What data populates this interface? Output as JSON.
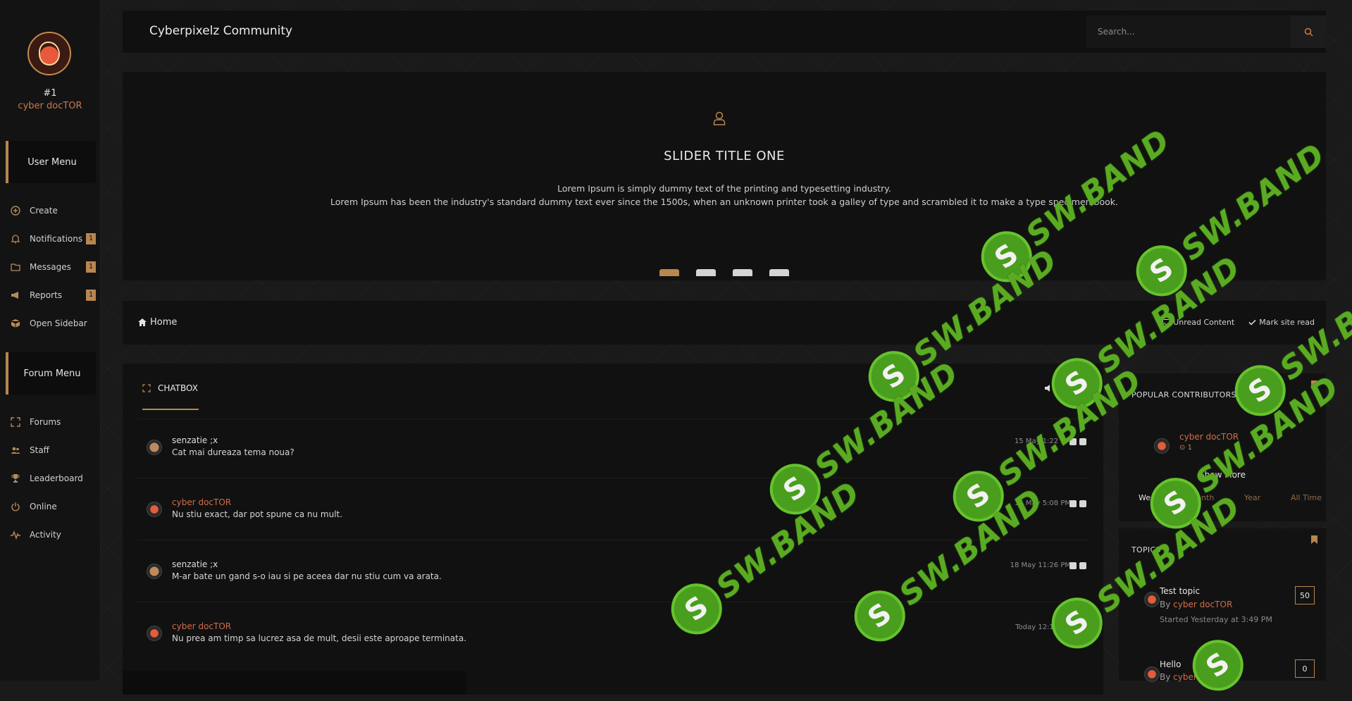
{
  "sidebar": {
    "rank": "#1",
    "username": "cyber docTOR",
    "user_menu_label": "User Menu",
    "user_items": [
      {
        "label": "Create",
        "icon": "plus-circle-icon",
        "badge": ""
      },
      {
        "label": "Notifications",
        "icon": "bell-icon",
        "badge": "1"
      },
      {
        "label": "Messages",
        "icon": "folder-icon",
        "badge": "1"
      },
      {
        "label": "Reports",
        "icon": "megaphone-icon",
        "badge": "1"
      },
      {
        "label": "Open Sidebar",
        "icon": "cube-icon",
        "badge": ""
      }
    ],
    "forum_menu_label": "Forum Menu",
    "forum_items": [
      {
        "label": "Forums",
        "icon": "expand-icon"
      },
      {
        "label": "Staff",
        "icon": "users-icon"
      },
      {
        "label": "Leaderboard",
        "icon": "trophy-icon"
      },
      {
        "label": "Online",
        "icon": "power-icon"
      },
      {
        "label": "Activity",
        "icon": "pulse-icon"
      }
    ]
  },
  "header": {
    "title": "Cyberpixelz Community",
    "search_placeholder": "Search..."
  },
  "slider": {
    "title": "SLIDER TITLE ONE",
    "line1": "Lorem Ipsum is simply dummy text of the printing and typesetting industry.",
    "line2": "Lorem Ipsum has been the industry's standard dummy text ever since the 1500s, when an unknown printer took a galley of type and scrambled it to make a type specimen book.",
    "slides": 4,
    "active_slide": 1
  },
  "breadcrumb": {
    "home": "Home",
    "unread": "Unread Content",
    "mark_read": "Mark site read"
  },
  "chatbox": {
    "tab_label": "CHATBOX",
    "messages": [
      {
        "author": "senzatie ;x",
        "text": "Cat mai dureaza tema noua?",
        "time": "15 May 1:22 PM",
        "avatar": "s"
      },
      {
        "author": "cyber docTOR",
        "text": "Nu stiu exact, dar pot spune ca nu mult.",
        "time": "15 May 5:08 PM",
        "avatar": "d"
      },
      {
        "author": "senzatie ;x",
        "text": "M-ar bate un gand s-o iau si pe aceea dar nu stiu cum va arata.",
        "time": "18 May 11:26 PM",
        "avatar": "s"
      },
      {
        "author": "cyber docTOR",
        "text": "Nu prea am timp sa lucrez asa de mult, desii este aproape terminata.",
        "time": "Today 12:15 PM",
        "avatar": "d"
      }
    ]
  },
  "popular_contributors": {
    "title": "POPULAR CONTRIBUTORS",
    "contributor_name": "cyber docTOR",
    "contributor_rep": "1",
    "show_more": "Show More",
    "periods": [
      "Week",
      "Month",
      "Year",
      "All Time"
    ],
    "active_period": "Week"
  },
  "topics": {
    "title": "TOPICS",
    "items": [
      {
        "title": "Test topic",
        "by_prefix": "By",
        "author": "cyber docTOR",
        "started": "Started Yesterday at 3:49 PM",
        "count": "50"
      },
      {
        "title": "Hello",
        "by_prefix": "By",
        "author": "cyber docTOR",
        "started": "",
        "count": "0"
      }
    ]
  },
  "watermark": {
    "text": "SW.BAND",
    "letter": "S"
  },
  "colors": {
    "accent": "#b8864f",
    "highlight": "#d06d4a",
    "panel": "#111111",
    "watermark_green": "#5aab22"
  }
}
